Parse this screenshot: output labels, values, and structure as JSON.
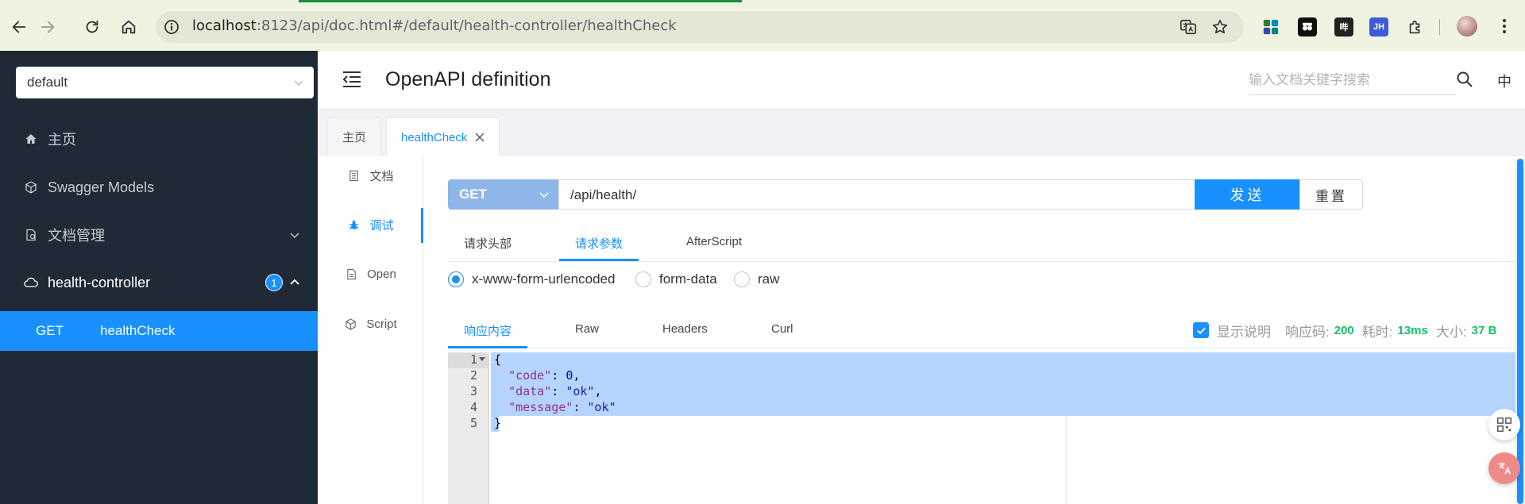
{
  "browser": {
    "url_host": "localhost",
    "url_rest": ":8123/api/doc.html#/default/health-controller/healthCheck",
    "extensions": [
      {
        "icon": "grid-apps-icon",
        "label": ""
      },
      {
        "icon": "extension-dark-icon",
        "label": ""
      },
      {
        "icon": "bilibili-icon",
        "label": "哔"
      },
      {
        "icon": "jh-extension-icon",
        "label": "JH"
      },
      {
        "icon": "puzzle-icon",
        "label": ""
      }
    ]
  },
  "sidebar": {
    "group_select": "default",
    "items": [
      {
        "icon": "home-icon",
        "label": "主页"
      },
      {
        "icon": "models-icon",
        "label": "Swagger Models"
      },
      {
        "icon": "doc-manage-icon",
        "label": "文档管理"
      },
      {
        "icon": "cloud-icon",
        "label": "health-controller",
        "badge": "1"
      }
    ],
    "sub_item": {
      "method": "GET",
      "name": "healthCheck"
    }
  },
  "header": {
    "title": "OpenAPI definition",
    "search_placeholder": "输入文档关键字搜索",
    "lang": "中"
  },
  "tabs": [
    {
      "label": "主页",
      "active": false
    },
    {
      "label": "healthCheck",
      "active": true
    }
  ],
  "vmenu": [
    {
      "icon": "document-icon",
      "label": "文档"
    },
    {
      "icon": "bug-icon",
      "label": "调试",
      "active": true
    },
    {
      "icon": "file-icon",
      "label": "Open"
    },
    {
      "icon": "code-icon",
      "label": "Script"
    }
  ],
  "request": {
    "method": "GET",
    "url": "/api/health/",
    "send_label": "发送",
    "reset_label": "重置",
    "tabs": [
      "请求头部",
      "请求参数",
      "AfterScript"
    ],
    "active_tab": "请求参数",
    "body_types": [
      "x-www-form-urlencoded",
      "form-data",
      "raw"
    ],
    "selected_body_type": "x-www-form-urlencoded"
  },
  "response": {
    "tabs": [
      "响应内容",
      "Raw",
      "Headers",
      "Curl"
    ],
    "active_tab": "响应内容",
    "show_desc_label": "显示说明",
    "show_desc_checked": true,
    "code_label": "响应码:",
    "code_value": "200",
    "time_label": "耗时:",
    "time_value": "13ms",
    "size_label": "大小:",
    "size_value": "37 B",
    "line_numbers": [
      "1",
      "2",
      "3",
      "4",
      "5"
    ]
  },
  "colors": {
    "primary": "#1890ff",
    "sidebar_bg": "#1f2a36",
    "success": "#19be6b",
    "selection": "#b5d5ff"
  }
}
